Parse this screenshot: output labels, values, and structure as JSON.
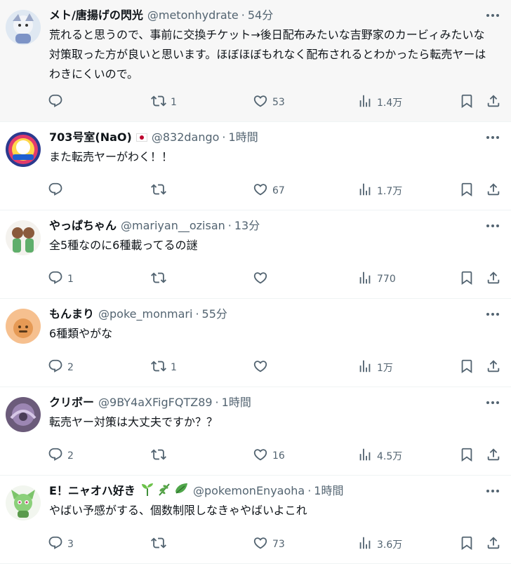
{
  "tweets": [
    {
      "name": "メト/唐揚げの閃光",
      "handle": "@metonhydrate",
      "time": "54分",
      "text": "荒れると思うので、事前に交換チケット→後日配布みたいな吉野家のカービィみたいな対策取った方が良いと思います。ほぼほぼもれなく配布されるとわかったら転売ヤーはわきにくいので。",
      "replies": "",
      "reposts": "1",
      "likes": "53",
      "views": "1.4万"
    },
    {
      "name": "703号室(NaO)",
      "handle": "@832dango",
      "time": "1時間",
      "text": "また転売ヤーがわく！！",
      "replies": "",
      "reposts": "",
      "likes": "67",
      "views": "1.7万"
    },
    {
      "name": "やっぱちゃん",
      "handle": "@mariyan__ozisan",
      "time": "13分",
      "text": "全5種なのに6種載ってるの謎",
      "replies": "1",
      "reposts": "",
      "likes": "",
      "views": "770"
    },
    {
      "name": "もんまり",
      "handle": "@poke_monmari",
      "time": "55分",
      "text": "6種類やがな",
      "replies": "2",
      "reposts": "1",
      "likes": "",
      "views": "1万"
    },
    {
      "name": "クリボー",
      "handle": "@9BY4aXFigFQTZ89",
      "time": "1時間",
      "text": "転売ヤー対策は大丈夫ですか？？",
      "replies": "2",
      "reposts": "",
      "likes": "16",
      "views": "4.5万"
    },
    {
      "name": "E！ニャオハ好き",
      "handle": "@pokemonEnyaoha",
      "time": "1時間",
      "text": "やばい予感がする、個数制限しなきゃやばいよこれ",
      "replies": "3",
      "reposts": "",
      "likes": "73",
      "views": "3.6万"
    }
  ],
  "colors": {
    "text": "#0f1419",
    "secondary": "#536471",
    "border": "#eff3f4",
    "flag_red": "#bc002d"
  },
  "icons": [
    "reply-icon",
    "repost-icon",
    "like-icon",
    "views-icon",
    "bookmark-icon",
    "share-icon",
    "more-icon"
  ]
}
